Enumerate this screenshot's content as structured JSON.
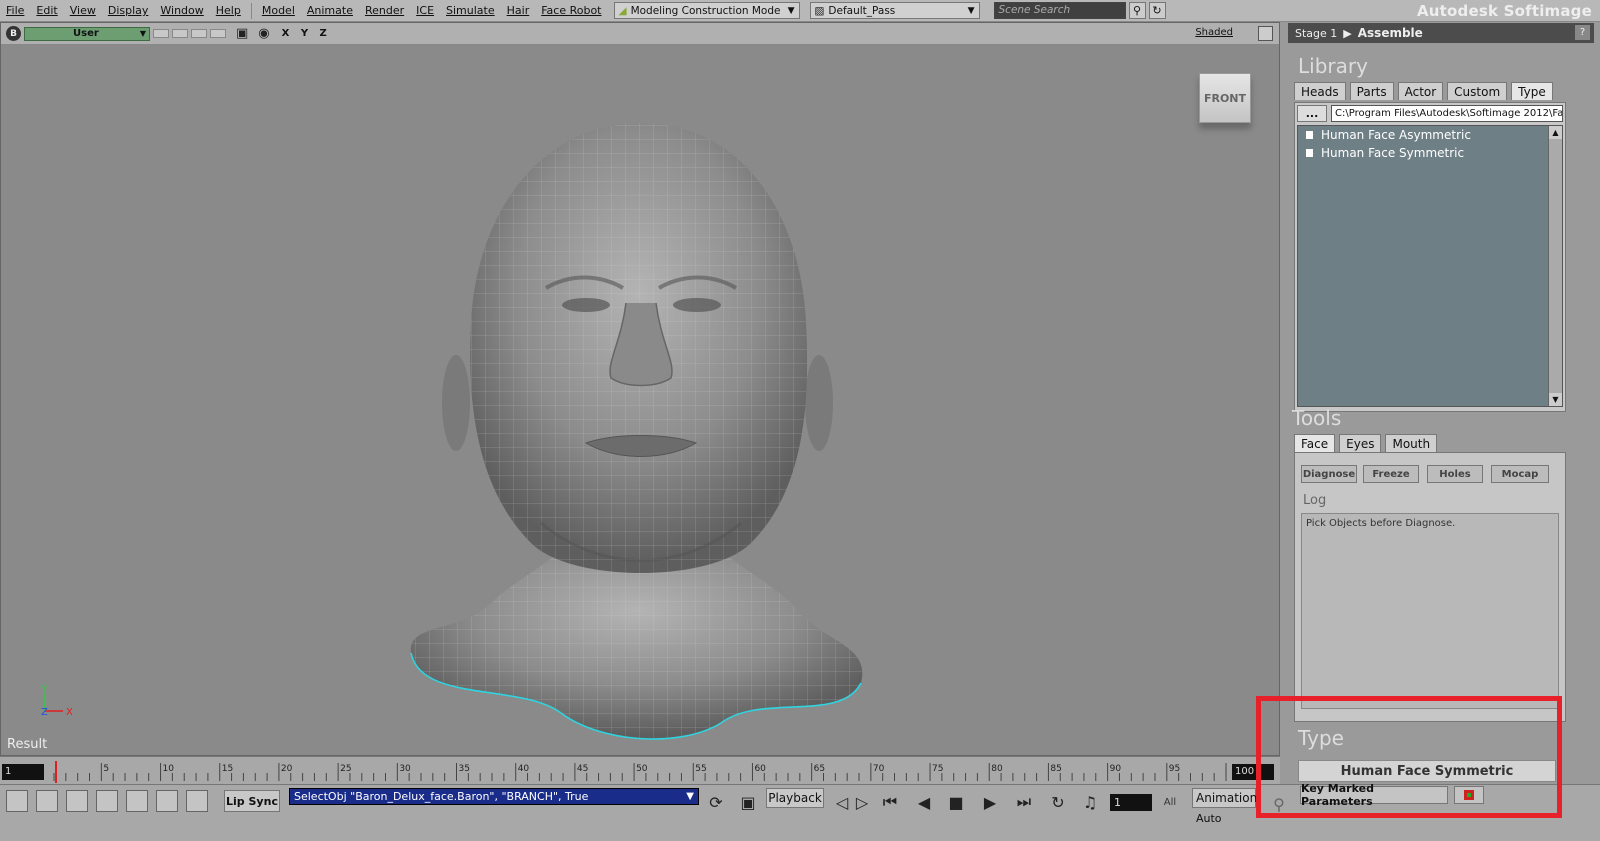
{
  "menubar": {
    "items": [
      "File",
      "Edit",
      "View",
      "Display",
      "Window",
      "Help",
      "Model",
      "Animate",
      "Render",
      "ICE",
      "Simulate",
      "Hair",
      "Face Robot"
    ],
    "mode": "Modeling Construction Mode",
    "pass": "Default_Pass",
    "search_placeholder": "Scene Search",
    "brand": "Autodesk Softimage"
  },
  "viewport": {
    "camera": "User",
    "axes": "X Y Z",
    "display_mode": "Shaded",
    "view_cube": "FRONT",
    "gizmo": {
      "y": "Y",
      "z": "Z",
      "x": "X"
    },
    "result_label": "Result",
    "accent": "#2fd4e0"
  },
  "stage": {
    "label": "Stage 1",
    "name": "Assemble",
    "help": "?"
  },
  "library": {
    "title": "Library",
    "tabs": [
      "Heads",
      "Parts",
      "Actor",
      "Custom",
      "Type"
    ],
    "active_tab": "Type",
    "path_button": "...",
    "path": "C:\\Program Files\\Autodesk\\Softimage 2012\\Fa",
    "items": [
      "Human Face Asymmetric",
      "Human Face Symmetric"
    ]
  },
  "tools": {
    "title": "Tools",
    "tabs": [
      "Face",
      "Eyes",
      "Mouth"
    ],
    "active_tab": "Face",
    "buttons": [
      "Diagnose",
      "Freeze",
      "Holes",
      "Mocap"
    ],
    "log_label": "Log",
    "log_text": "Pick Objects before Diagnose."
  },
  "type_section": {
    "title": "Type",
    "value": "Human Face Symmetric"
  },
  "timeline": {
    "start": "1",
    "end": "100",
    "ticks": [
      "5",
      "10",
      "15",
      "20",
      "25",
      "30",
      "35",
      "40",
      "45",
      "50",
      "55",
      "60",
      "65",
      "70",
      "75",
      "80",
      "85",
      "90",
      "95"
    ]
  },
  "bottombar": {
    "lip_sync": "Lip Sync",
    "command": "SelectObj \"Baron_Delux_face.Baron\", \"BRANCH\", True",
    "playback": "Playback",
    "current_frame": "1",
    "all": "All",
    "animation": "Animation",
    "auto": "Auto",
    "key_marked": "Key Marked Parameters"
  },
  "highlight_color": "#e8202a"
}
